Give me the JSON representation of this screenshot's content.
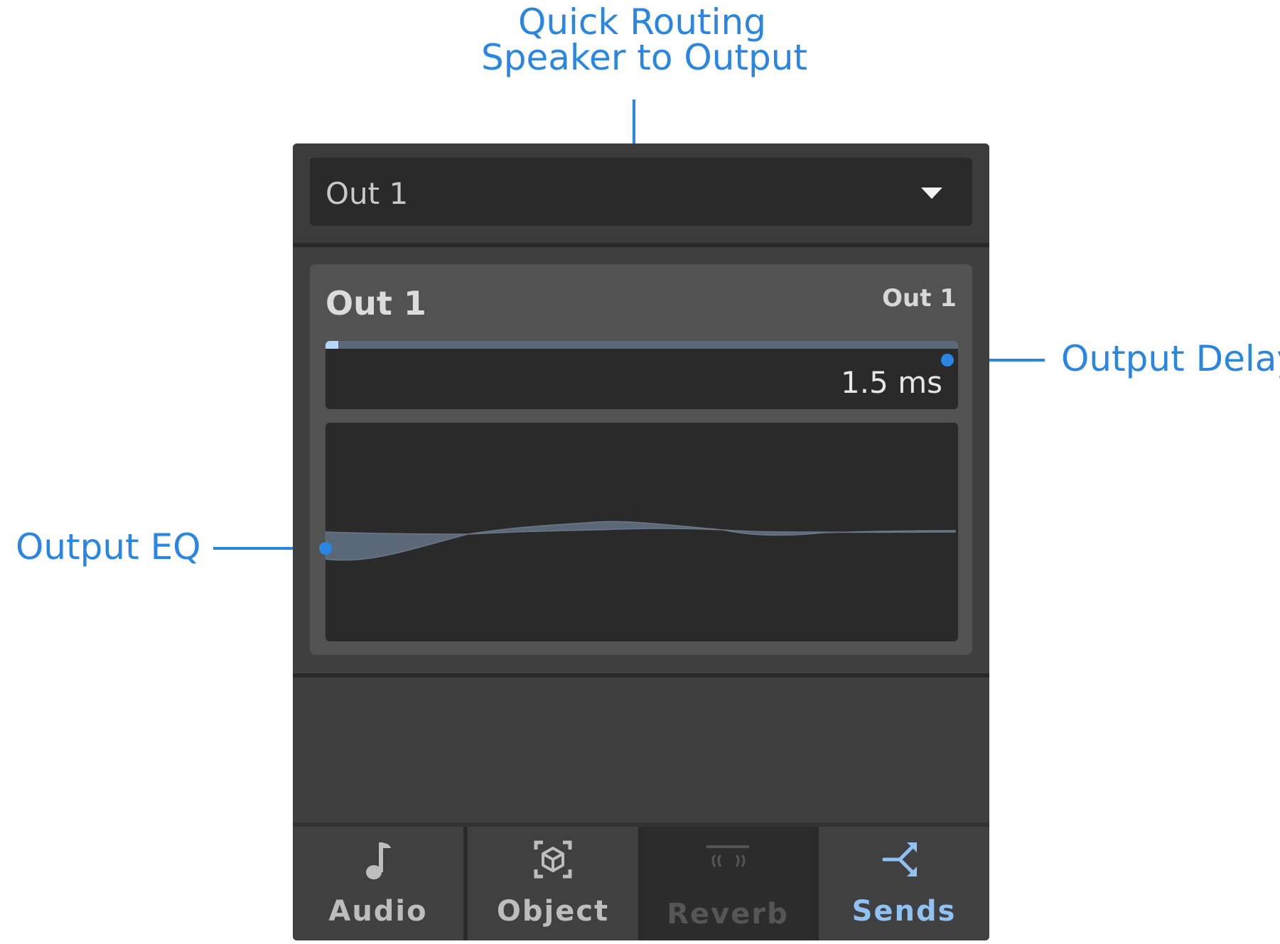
{
  "callouts": {
    "routing_line1": "Quick Routing",
    "routing_line2": "Speaker to Output",
    "delay": "Output Delay",
    "eq": "Output EQ"
  },
  "routing": {
    "selected_output": "Out 1"
  },
  "output_card": {
    "title": "Out 1",
    "subtitle": "Out 1",
    "delay": {
      "value": "1.5 ms",
      "fill_fraction": 0.02
    }
  },
  "tabs": [
    {
      "label": "Audio",
      "icon": "music-note-icon",
      "state": "normal"
    },
    {
      "label": "Object",
      "icon": "cube-icon",
      "state": "normal"
    },
    {
      "label": "Reverb",
      "icon": "reverb-icon",
      "state": "disabled"
    },
    {
      "label": "Sends",
      "icon": "sends-icon",
      "state": "active"
    }
  ],
  "colors": {
    "annotation": "#2a86e3",
    "active_tab": "#8fc2f2",
    "panel_bg": "#333333",
    "eq_fill": "#5a6878"
  }
}
